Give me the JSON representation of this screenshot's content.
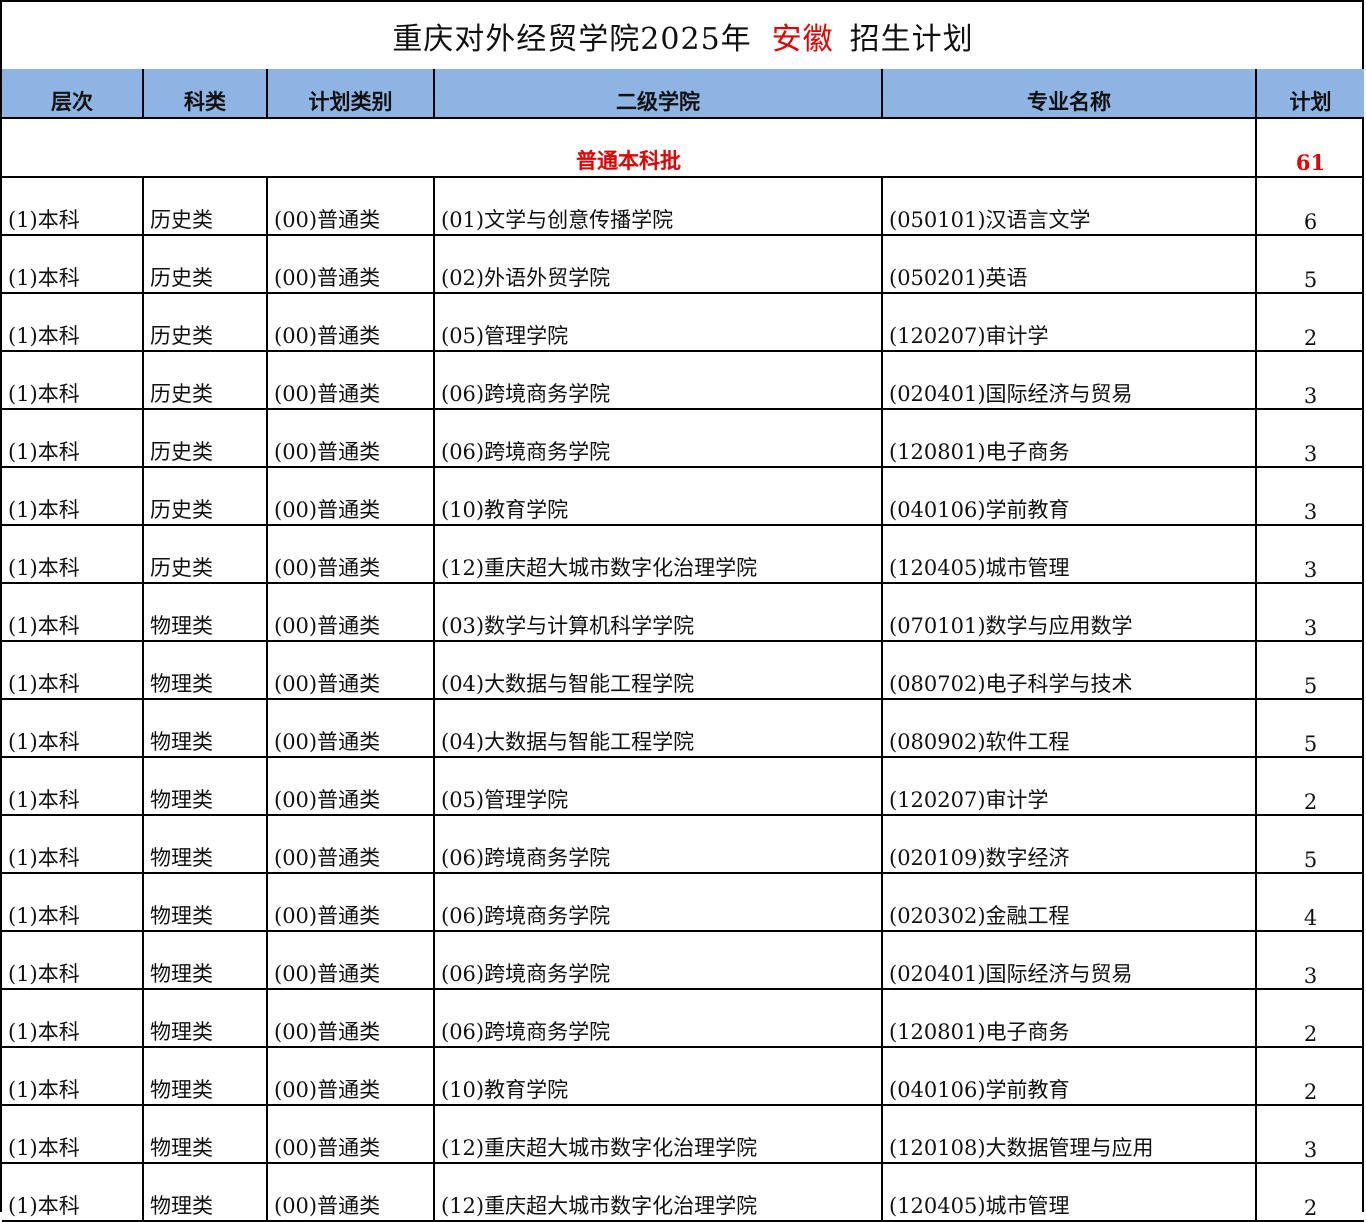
{
  "title": {
    "prefix": "重庆对外经贸学院2025年",
    "province": "安徽",
    "suffix": "招生计划"
  },
  "colors": {
    "header_bg": "#8db4e2",
    "accent_red": "#e00000"
  },
  "headers": [
    "层次",
    "科类",
    "计划类别",
    "二级学院",
    "专业名称",
    "计划"
  ],
  "batch": {
    "label": "普通本科批",
    "total": "61"
  },
  "rows": [
    [
      "(1)本科",
      "历史类",
      "(00)普通类",
      "(01)文学与创意传播学院",
      "(050101)汉语言文学",
      "6"
    ],
    [
      "(1)本科",
      "历史类",
      "(00)普通类",
      "(02)外语外贸学院",
      "(050201)英语",
      "5"
    ],
    [
      "(1)本科",
      "历史类",
      "(00)普通类",
      "(05)管理学院",
      "(120207)审计学",
      "2"
    ],
    [
      "(1)本科",
      "历史类",
      "(00)普通类",
      "(06)跨境商务学院",
      "(020401)国际经济与贸易",
      "3"
    ],
    [
      "(1)本科",
      "历史类",
      "(00)普通类",
      "(06)跨境商务学院",
      "(120801)电子商务",
      "3"
    ],
    [
      "(1)本科",
      "历史类",
      "(00)普通类",
      "(10)教育学院",
      "(040106)学前教育",
      "3"
    ],
    [
      "(1)本科",
      "历史类",
      "(00)普通类",
      "(12)重庆超大城市数字化治理学院",
      "(120405)城市管理",
      "3"
    ],
    [
      "(1)本科",
      "物理类",
      "(00)普通类",
      "(03)数学与计算机科学学院",
      "(070101)数学与应用数学",
      "3"
    ],
    [
      "(1)本科",
      "物理类",
      "(00)普通类",
      "(04)大数据与智能工程学院",
      "(080702)电子科学与技术",
      "5"
    ],
    [
      "(1)本科",
      "物理类",
      "(00)普通类",
      "(04)大数据与智能工程学院",
      "(080902)软件工程",
      "5"
    ],
    [
      "(1)本科",
      "物理类",
      "(00)普通类",
      "(05)管理学院",
      "(120207)审计学",
      "2"
    ],
    [
      "(1)本科",
      "物理类",
      "(00)普通类",
      "(06)跨境商务学院",
      "(020109)数字经济",
      "5"
    ],
    [
      "(1)本科",
      "物理类",
      "(00)普通类",
      "(06)跨境商务学院",
      "(020302)金融工程",
      "4"
    ],
    [
      "(1)本科",
      "物理类",
      "(00)普通类",
      "(06)跨境商务学院",
      "(020401)国际经济与贸易",
      "3"
    ],
    [
      "(1)本科",
      "物理类",
      "(00)普通类",
      "(06)跨境商务学院",
      "(120801)电子商务",
      "2"
    ],
    [
      "(1)本科",
      "物理类",
      "(00)普通类",
      "(10)教育学院",
      "(040106)学前教育",
      "2"
    ],
    [
      "(1)本科",
      "物理类",
      "(00)普通类",
      "(12)重庆超大城市数字化治理学院",
      "(120108)大数据管理与应用",
      "3"
    ],
    [
      "(1)本科",
      "物理类",
      "(00)普通类",
      "(12)重庆超大城市数字化治理学院",
      "(120405)城市管理",
      "2"
    ]
  ]
}
